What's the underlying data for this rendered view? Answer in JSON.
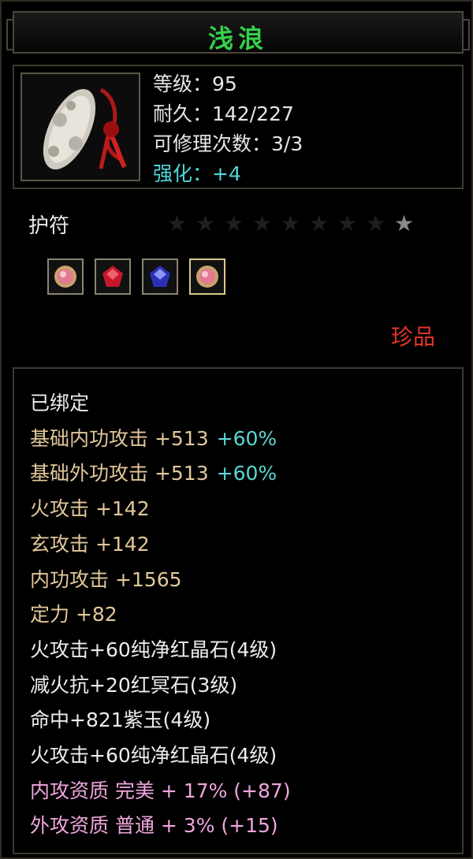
{
  "title": "浅浪",
  "stats": {
    "level": "等级：95",
    "durability": "耐久：142/227",
    "repair": "可修理次数：3/3",
    "enhance": "强化：+4"
  },
  "item_type": "护符",
  "stars": {
    "total": 9,
    "lit": 1
  },
  "gems": [
    {
      "icon": "pink-orb-gem-icon"
    },
    {
      "icon": "red-crystal-gem-icon"
    },
    {
      "icon": "blue-crystal-gem-icon"
    },
    {
      "icon": "pink-orb-gem-icon"
    }
  ],
  "rarity": "珍品",
  "attributes": [
    {
      "text": "已绑定",
      "bonus": ""
    },
    {
      "text": "基础内功攻击 +513",
      "bonus": "+60%"
    },
    {
      "text": "基础外功攻击 +513",
      "bonus": "+60%"
    },
    {
      "text": "火攻击 +142",
      "bonus": ""
    },
    {
      "text": "玄攻击 +142",
      "bonus": ""
    },
    {
      "text": "内功攻击 +1565",
      "bonus": ""
    },
    {
      "text": "定力 +82",
      "bonus": ""
    },
    {
      "text": "火攻击+60纯净红晶石(4级)",
      "bonus": ""
    },
    {
      "text": "减火抗+20红冥石(3级)",
      "bonus": ""
    },
    {
      "text": "命中+821紫玉(4级)",
      "bonus": ""
    },
    {
      "text": "火攻击+60纯净红晶石(4级)",
      "bonus": ""
    },
    {
      "text": "内攻资质 完美 + 17% (+87)",
      "bonus": ""
    },
    {
      "text": "外攻资质 普通 + 3% (+15)",
      "bonus": ""
    }
  ],
  "colors": {
    "title": "#35d04a",
    "enhance": "#4fd6dc",
    "rarity": "#e0342a",
    "base_attr": "#e2c79a",
    "quality": "#f0a6de",
    "bonus": "#59d7d3"
  }
}
